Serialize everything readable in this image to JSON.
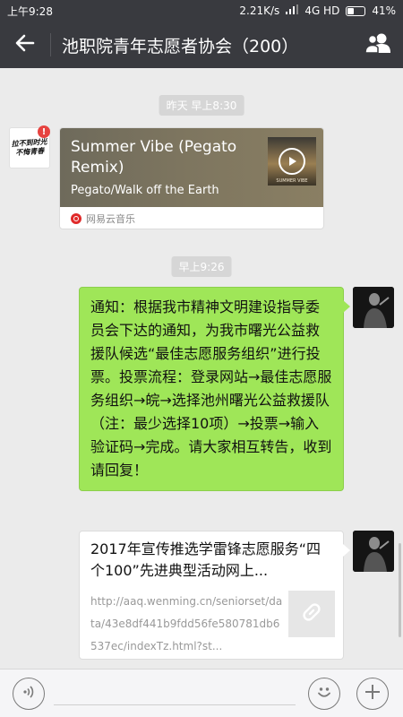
{
  "status_bar": {
    "time": "上午9:28",
    "network_speed": "2.21K/s",
    "network_type": "4G HD",
    "battery": "41%",
    "battery_level": 0.41
  },
  "header": {
    "title": "池职院青年志愿者协会（200）",
    "back_icon": "back-arrow-icon",
    "group_icon": "group-members-icon"
  },
  "chat": {
    "messages": [
      {
        "type": "timestamp",
        "text": "昨天 早上8:30"
      },
      {
        "type": "music",
        "side": "left",
        "sender_avatar_text": "拉不到时光 不悔青春",
        "sender_badge": "!",
        "title": "Summer Vibe (Pegato Remix)",
        "artist": "Pegato/Walk off the Earth",
        "source": "网易云音乐",
        "cover_text": "SUMMER VIBE"
      },
      {
        "type": "timestamp",
        "text": "早上9:26"
      },
      {
        "type": "text",
        "side": "right",
        "text": "通知：根据我市精神文明建设指导委员会下达的通知，为我市曙光公益救援队候选“最佳志愿服务组织”进行投票。投票流程：登录网站→最佳志愿服务组织→皖→选择池州曙光公益救援队（注：最少选择10项）→投票→输入验证码→完成。请大家相互转告，收到请回复！"
      },
      {
        "type": "link",
        "side": "right",
        "title": "2017年宣传推选学雷锋志愿服务“四个100”先进典型活动网上...",
        "url": "http://aaq.wenming.cn/seniorset/data/43e8df441b9fdd56fe580781db6537ec/indexTz.html?st..."
      }
    ]
  },
  "input_bar": {
    "voice_icon": "voice-icon",
    "emoji_icon": "emoji-icon",
    "plus_icon": "plus-icon",
    "placeholder": ""
  },
  "colors": {
    "header_bg": "#393a3f",
    "chat_bg": "#ebebeb",
    "sent_bubble": "#9fe658",
    "badge": "#e64340"
  }
}
